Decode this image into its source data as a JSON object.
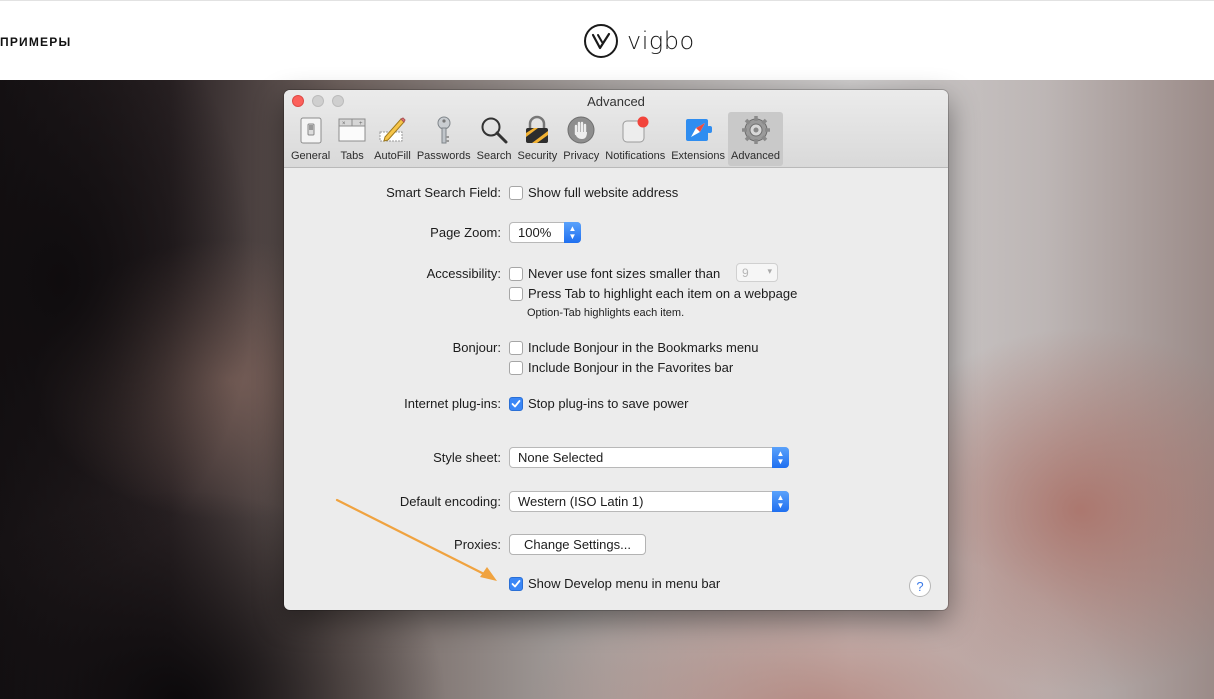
{
  "site": {
    "nav_link": "ПРИМЕРЫ",
    "logo_text": "vigbo"
  },
  "window": {
    "title": "Advanced",
    "toolbar": [
      {
        "label": "General",
        "icon": "general-switch-icon"
      },
      {
        "label": "Tabs",
        "icon": "tabs-icon"
      },
      {
        "label": "AutoFill",
        "icon": "pencil-form-icon"
      },
      {
        "label": "Passwords",
        "icon": "key-icon"
      },
      {
        "label": "Search",
        "icon": "magnifier-icon"
      },
      {
        "label": "Security",
        "icon": "padlock-icon"
      },
      {
        "label": "Privacy",
        "icon": "hand-icon"
      },
      {
        "label": "Notifications",
        "icon": "notification-badge-icon"
      },
      {
        "label": "Extensions",
        "icon": "compass-puzzle-icon"
      },
      {
        "label": "Advanced",
        "icon": "gear-icon",
        "selected": true
      }
    ],
    "smart_search": {
      "label": "Smart Search Field:",
      "option": "Show full website address",
      "checked": false
    },
    "page_zoom": {
      "label": "Page Zoom:",
      "value": "100%"
    },
    "accessibility": {
      "label": "Accessibility:",
      "option1": "Never use font sizes smaller than",
      "option1_value": "9",
      "option2": "Press Tab to highlight each item on a webpage",
      "note": "Option-Tab highlights each item."
    },
    "bonjour": {
      "label": "Bonjour:",
      "option1": "Include Bonjour in the Bookmarks menu",
      "option2": "Include Bonjour in the Favorites bar"
    },
    "plugins": {
      "label": "Internet plug-ins:",
      "option": "Stop plug-ins to save power",
      "checked": true
    },
    "style_sheet": {
      "label": "Style sheet:",
      "value": "None Selected"
    },
    "encoding": {
      "label": "Default encoding:",
      "value": "Western (ISO Latin 1)"
    },
    "proxies": {
      "label": "Proxies:",
      "button": "Change Settings..."
    },
    "develop": {
      "option": "Show Develop menu in menu bar",
      "checked": true
    },
    "help_glyph": "?"
  },
  "colors": {
    "accent_blue": "#3b87f6",
    "annotation_arrow": "#f0a340",
    "close_red": "#fc605b"
  }
}
